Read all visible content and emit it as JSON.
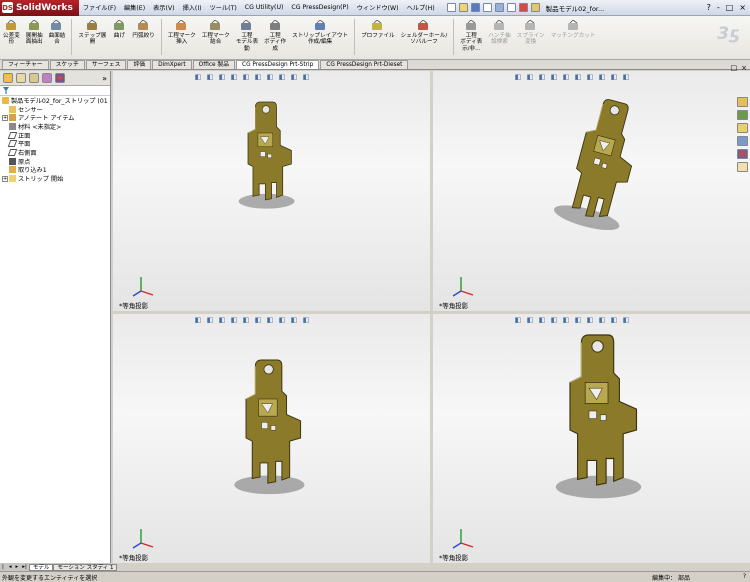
{
  "app": {
    "name": "SolidWorks"
  },
  "menu": [
    "ファイル(F)",
    "編集(E)",
    "表示(V)",
    "挿入(I)",
    "ツール(T)",
    "CG Utility(U)",
    "CG PressDesign(P)",
    "ウィンドウ(W)",
    "ヘルプ(H)"
  ],
  "document_title": "製品モデル02_for...",
  "window_controls": [
    "?",
    "-",
    "□",
    "×"
  ],
  "ribbon": [
    {
      "label": "公差変\n形",
      "icon": "tolerance-icon",
      "color": "#b88a1a"
    },
    {
      "label": "展開抽\n面抽出",
      "icon": "unfold-icon",
      "color": "#7a8a3a"
    },
    {
      "label": "曲面結\n合",
      "icon": "surface-knit-icon",
      "color": "#5a7a9a"
    },
    {
      "label": "ステップ展\n開",
      "icon": "step-unfold-icon",
      "color": "#8a6a2a"
    },
    {
      "label": "曲げ",
      "icon": "bend-icon",
      "color": "#6a8a4a"
    },
    {
      "label": "円弧絞り",
      "icon": "arc-draw-icon",
      "color": "#a87a3a"
    },
    {
      "label": "工程マーク\n挿入",
      "icon": "process-mark-icon",
      "color": "#c8782a"
    },
    {
      "label": "工程マーク\n結合",
      "icon": "process-merge-icon",
      "color": "#8a7a4a"
    },
    {
      "label": "工程\nモデル表\n動",
      "icon": "process-model-icon",
      "color": "#5a6a8a"
    },
    {
      "label": "工程\nボディ作\n成",
      "icon": "process-body-icon",
      "color": "#6a6a6a"
    },
    {
      "label": "ストリップレイアウト\n作成/編集",
      "icon": "strip-layout-icon",
      "color": "#4a6aa8"
    },
    {
      "label": "プロファイル",
      "icon": "profile-icon",
      "color": "#b8a82a"
    },
    {
      "label": "シェルダーホール/\nソバルーフ",
      "icon": "shoulder-hole-icon",
      "color": "#b83a2a"
    },
    {
      "label": "工程\nボディ表\n示/非...",
      "icon": "body-visibility-icon",
      "color": "#8a8a8a"
    },
    {
      "label": "ハンチ抽\n設検索",
      "icon": "search-icon",
      "color": "#aaaaaa",
      "disabled": true
    },
    {
      "label": "スプライン\n変換",
      "icon": "spline-icon",
      "color": "#aaaaaa",
      "disabled": true
    },
    {
      "label": "マッチングカット",
      "icon": "matching-cut-icon",
      "color": "#aaaaaa",
      "disabled": true
    }
  ],
  "tabs": [
    "フィーチャー",
    "スケッチ",
    "サーフェス",
    "評価",
    "DimXpert",
    "Office 製品",
    "CG PressDesign Prt-Strip",
    "CG PressDesign Prt-Dieset"
  ],
  "active_tab": "CG PressDesign Prt-Strip",
  "tree": {
    "root": "製品モデル02_for_ストリップ (01",
    "items": [
      {
        "label": "センサー",
        "icon": "sensor-icon",
        "expand": false
      },
      {
        "label": "アノテート アイテム",
        "icon": "annotation-icon",
        "expand": true
      },
      {
        "label": "材料 <未指定>",
        "icon": "material-icon",
        "expand": false
      },
      {
        "label": "正面",
        "icon": "plane-icon",
        "expand": false
      },
      {
        "label": "平面",
        "icon": "plane-icon",
        "expand": false
      },
      {
        "label": "右側面",
        "icon": "plane-icon",
        "expand": false
      },
      {
        "label": "原点",
        "icon": "origin-icon",
        "expand": false
      },
      {
        "label": "取り込み1",
        "icon": "import-icon",
        "expand": false
      },
      {
        "label": "ストリップ 開始",
        "icon": "folder-icon",
        "expand": true
      }
    ]
  },
  "viewports": [
    {
      "label": "*等角投影"
    },
    {
      "label": "*等角投影"
    },
    {
      "label": "*等角投影"
    },
    {
      "label": "*等角投影"
    }
  ],
  "bottom_tabs": [
    "モデル",
    "モーション スタディ 1"
  ],
  "status": {
    "left": "外観を変更するエンティティを選択",
    "mode": "編集中： 部品",
    "right": ""
  }
}
